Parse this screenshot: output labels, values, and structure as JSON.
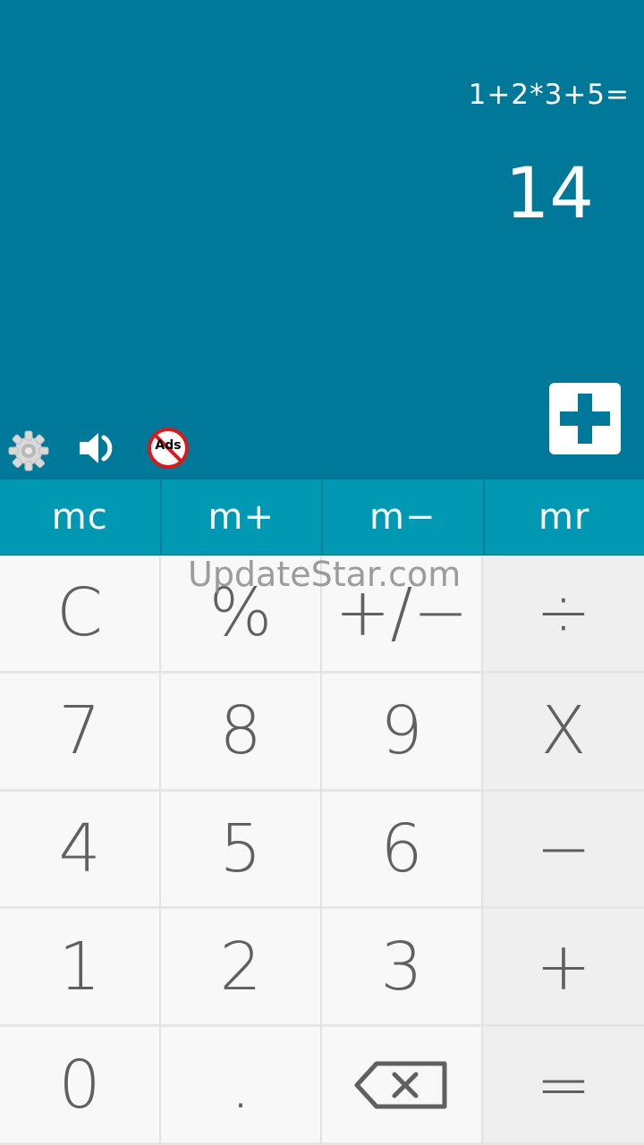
{
  "display": {
    "expression": "1+2*3+5=",
    "result": "14"
  },
  "toolbar": {
    "settings_icon": "gear-icon",
    "sound_icon": "speaker-icon",
    "noads_icon": "no-ads-icon",
    "noads_label": "Ads",
    "add_icon": "plus-icon"
  },
  "memory": {
    "keys": [
      "mc",
      "m+",
      "m−",
      "mr"
    ]
  },
  "keypad": {
    "row1": [
      "C",
      "%",
      "+/−",
      "÷"
    ],
    "row2": [
      "7",
      "8",
      "9",
      "X"
    ],
    "row3": [
      "4",
      "5",
      "6",
      "−"
    ],
    "row4": [
      "1",
      "2",
      "3",
      "+"
    ],
    "row5": [
      "0",
      ".",
      "backspace-icon",
      "="
    ]
  },
  "watermark": "UpdateStar.com",
  "colors": {
    "display_bg": "#00789a",
    "memory_bg": "#0098b3",
    "key_text": "#606060"
  }
}
